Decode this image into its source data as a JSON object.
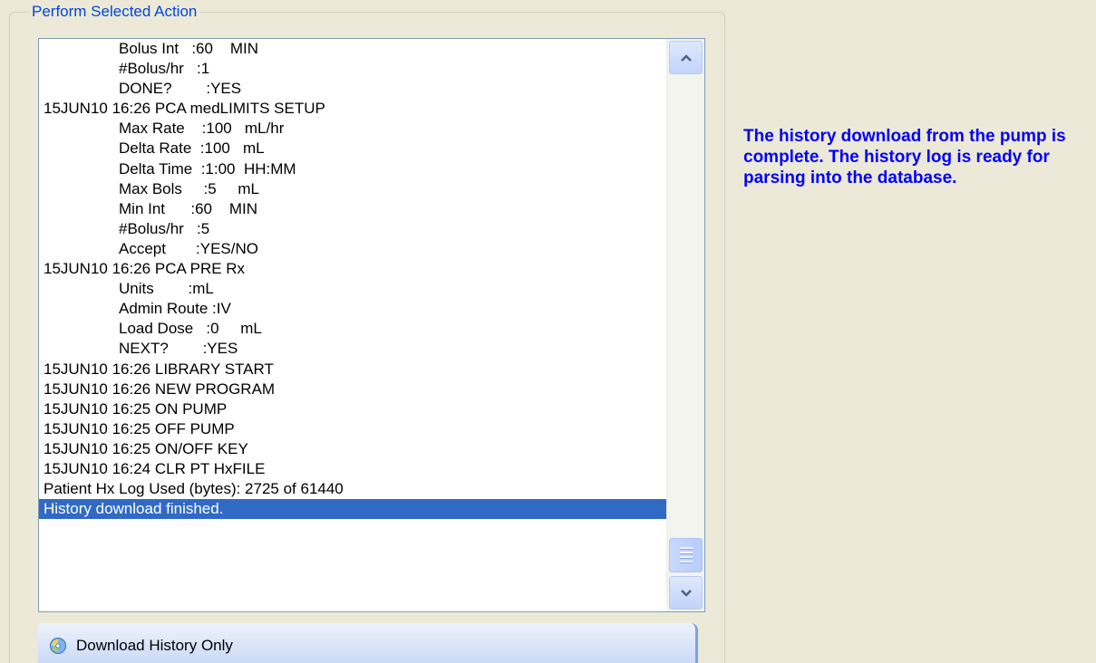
{
  "groupbox": {
    "title": "Perform Selected Action"
  },
  "log": {
    "rows": [
      {
        "text": "Bolus Int   :60    MIN",
        "indent": true,
        "selected": false
      },
      {
        "text": "#Bolus/hr   :1",
        "indent": true,
        "selected": false
      },
      {
        "text": "DONE?        :YES",
        "indent": true,
        "selected": false
      },
      {
        "text": "15JUN10 16:26 PCA medLIMITS SETUP",
        "indent": false,
        "selected": false
      },
      {
        "text": "Max Rate    :100   mL/hr",
        "indent": true,
        "selected": false
      },
      {
        "text": "Delta Rate  :100   mL",
        "indent": true,
        "selected": false
      },
      {
        "text": "Delta Time  :1:00  HH:MM",
        "indent": true,
        "selected": false
      },
      {
        "text": "Max Bols     :5     mL",
        "indent": true,
        "selected": false
      },
      {
        "text": "Min Int      :60    MIN",
        "indent": true,
        "selected": false
      },
      {
        "text": "#Bolus/hr   :5",
        "indent": true,
        "selected": false
      },
      {
        "text": "Accept       :YES/NO",
        "indent": true,
        "selected": false
      },
      {
        "text": "15JUN10 16:26 PCA PRE Rx",
        "indent": false,
        "selected": false
      },
      {
        "text": "Units        :mL",
        "indent": true,
        "selected": false
      },
      {
        "text": "Admin Route :IV",
        "indent": true,
        "selected": false
      },
      {
        "text": "Load Dose   :0     mL",
        "indent": true,
        "selected": false
      },
      {
        "text": "NEXT?        :YES",
        "indent": true,
        "selected": false
      },
      {
        "text": "15JUN10 16:26 LIBRARY START",
        "indent": false,
        "selected": false
      },
      {
        "text": "15JUN10 16:26 NEW PROGRAM",
        "indent": false,
        "selected": false
      },
      {
        "text": "15JUN10 16:25 ON PUMP",
        "indent": false,
        "selected": false
      },
      {
        "text": "15JUN10 16:25 OFF PUMP",
        "indent": false,
        "selected": false
      },
      {
        "text": "15JUN10 16:25 ON/OFF KEY",
        "indent": false,
        "selected": false
      },
      {
        "text": "15JUN10 16:24 CLR PT HxFILE",
        "indent": false,
        "selected": false
      },
      {
        "text": "Patient Hx Log Used (bytes): 2725 of 61440",
        "indent": false,
        "selected": false
      },
      {
        "text": "History download finished.",
        "indent": false,
        "selected": true
      }
    ]
  },
  "message": {
    "text": "The history download from the pump is complete. The history log is ready for parsing into the database."
  },
  "button": {
    "label": "Download History Only",
    "icon": "download-disc-icon"
  },
  "colors": {
    "title": "#0046d5",
    "message": "#0000ff",
    "selection": "#316ac5",
    "background": "#ece9d8"
  }
}
